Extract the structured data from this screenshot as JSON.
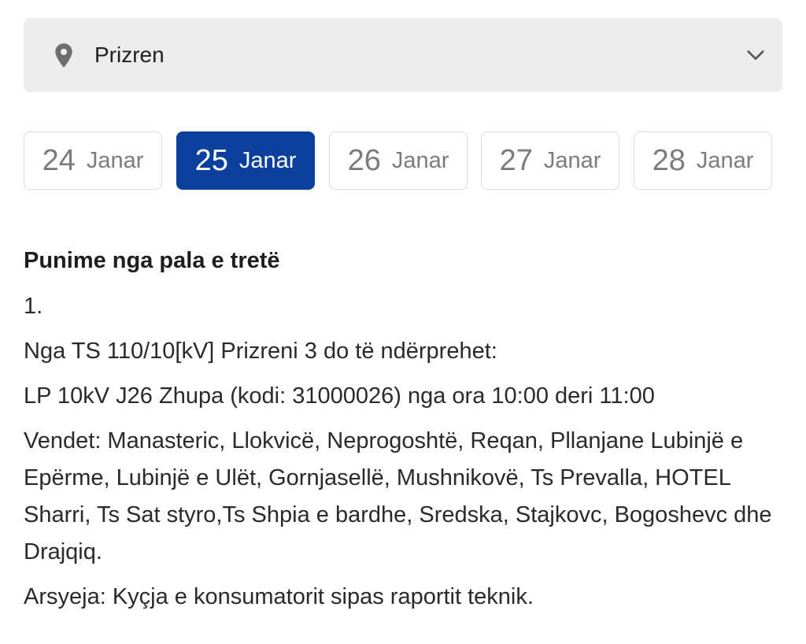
{
  "location": {
    "value": "Prizren",
    "icon": "map-pin-icon",
    "dropdown_icon": "chevron-down-icon"
  },
  "dates": [
    {
      "day": "24",
      "month": "Janar",
      "active": false
    },
    {
      "day": "25",
      "month": "Janar",
      "active": true
    },
    {
      "day": "26",
      "month": "Janar",
      "active": false
    },
    {
      "day": "27",
      "month": "Janar",
      "active": false
    },
    {
      "day": "28",
      "month": "Janar",
      "active": false
    }
  ],
  "colors": {
    "active_tab": "#0b419c",
    "select_bg": "#ececec"
  },
  "notice": {
    "heading": "Punime nga pala e tretë",
    "number": "1.",
    "source": "Nga TS 110/10[kV] Prizreni 3 do të ndërprehet:",
    "line": "LP 10kV J26 Zhupa (kodi: 31000026) nga ora 10:00 deri 11:00",
    "places": "Vendet: Manasteric, Llokvicë, Neprogoshtë, Reqan, Pllanjane Lubinjë e Epërme, Lubinjë e Ulët, Gornjasellë, Mushnikovë, Ts Prevalla, HOTEL Sharri, Ts Sat styro,Ts Shpia e bardhe, Sredska, Stajkovc, Bogoshevc dhe Drajqiq.",
    "reason": "Arsyeja: Kyçja e konsumatorit sipas raportit teknik."
  }
}
